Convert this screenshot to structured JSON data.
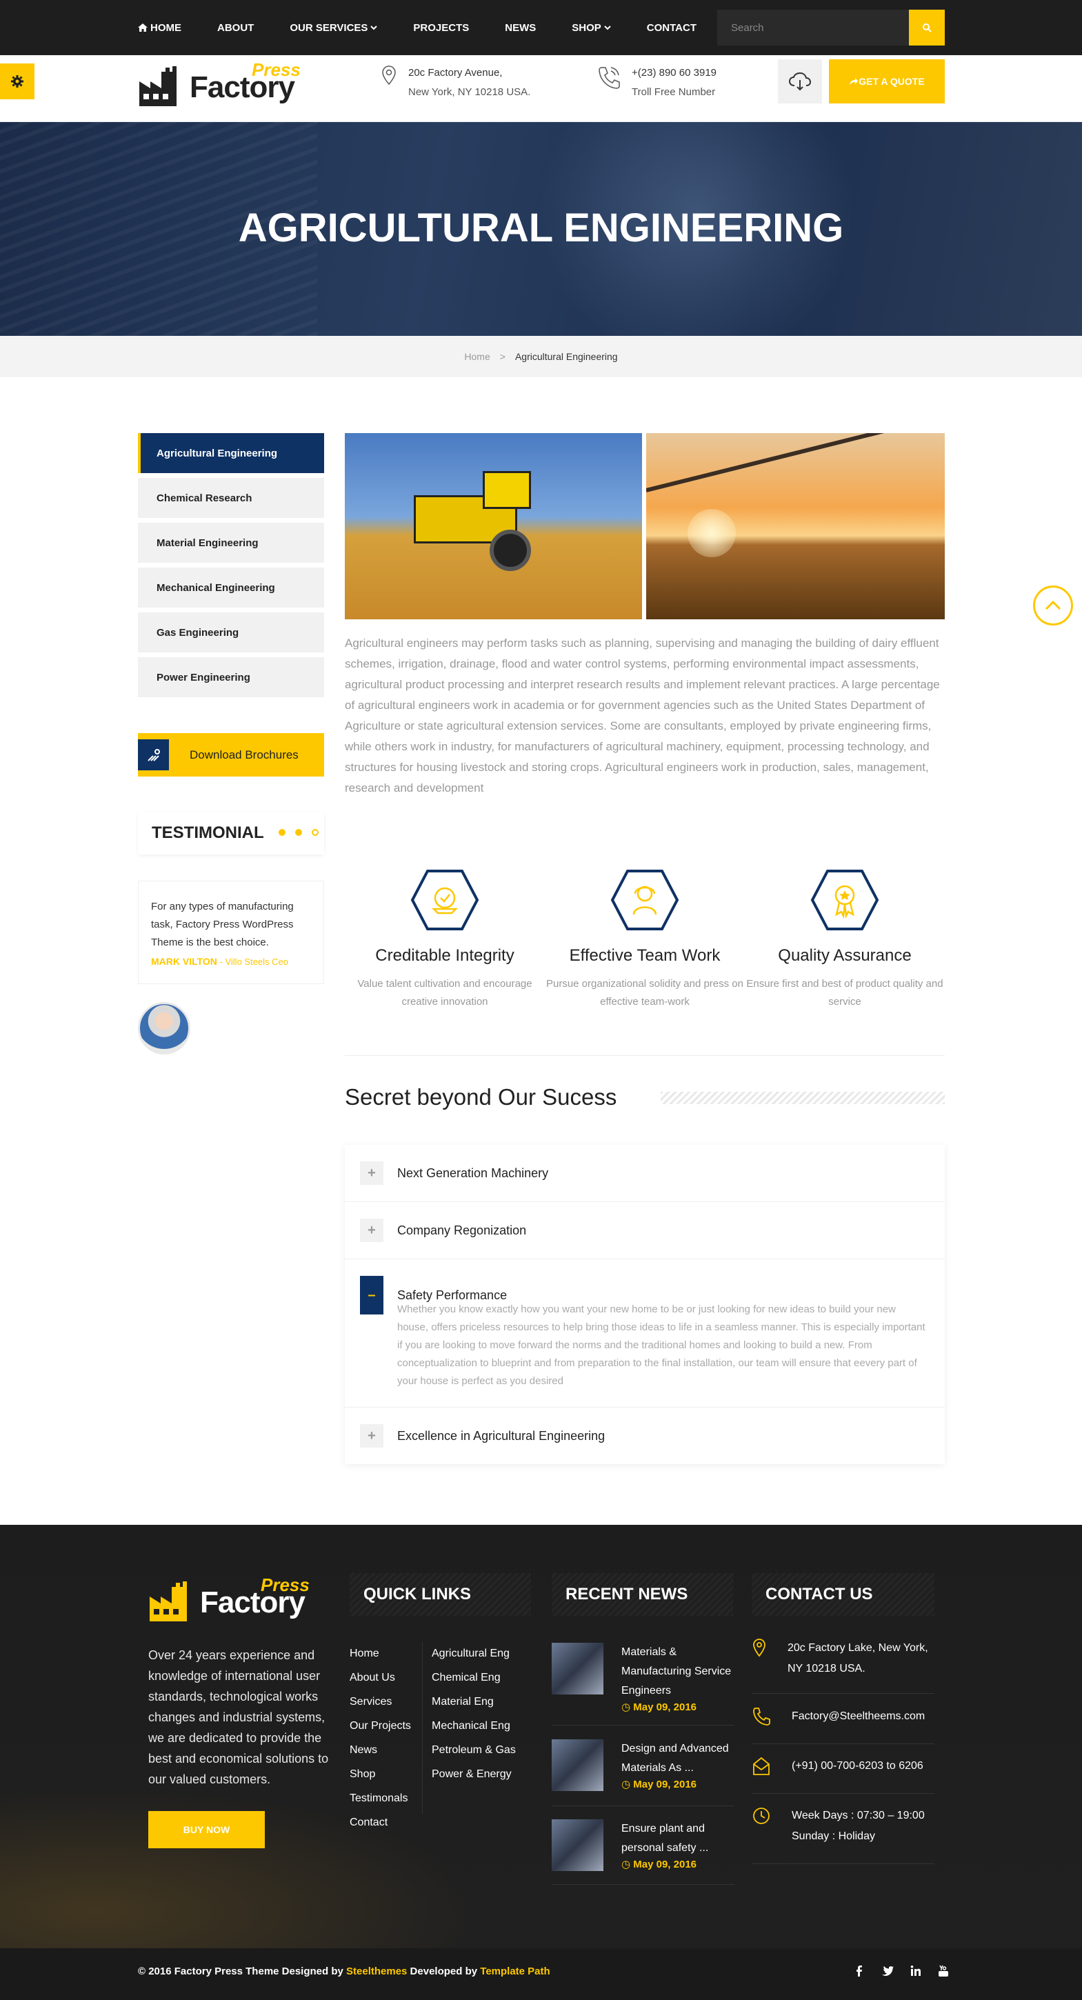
{
  "nav": {
    "items": [
      "HOME",
      "ABOUT",
      "OUR SERVICES",
      "PROJECTS",
      "NEWS",
      "SHOP",
      "CONTACT"
    ],
    "search_placeholder": "Search"
  },
  "header": {
    "logo_press": "Press",
    "logo_factory": "Factory",
    "address_line1": "20c Factory Avenue,",
    "address_line2": "New York, NY 10218 USA.",
    "phone": "+(23) 890 60 3919",
    "phone_label": "Troll Free Number",
    "quote_button": "GET A QUOTE"
  },
  "hero": {
    "title": "AGRICULTURAL ENGINEERING"
  },
  "breadcrumb": {
    "home": "Home",
    "separator": ">",
    "current": "Agricultural Engineering"
  },
  "sidebar": {
    "items": [
      {
        "label": "Agricultural Engineering",
        "active": true
      },
      {
        "label": "Chemical Research",
        "active": false
      },
      {
        "label": "Material Engineering",
        "active": false
      },
      {
        "label": "Mechanical Engineering",
        "active": false
      },
      {
        "label": "Gas Engineering",
        "active": false
      },
      {
        "label": "Power Engineering",
        "active": false
      }
    ],
    "download_label": "Download Brochures",
    "testimonial_title": "TESTIMONIAL",
    "testimonial_quote": "For any types of manufacturing task, Factory Press WordPress Theme is the best choice.",
    "testimonial_name": "MARK VILTON",
    "testimonial_position": " - Villo Steels Ceo"
  },
  "main": {
    "body": "Agricultural engineers may perform tasks such as planning, supervising and managing the building of dairy effluent schemes, irrigation, drainage, flood and water control systems, performing environmental impact assessments, agricultural product processing and interpret research results and implement relevant practices. A large percentage of agricultural engineers work in academia or for government agencies such as the United States Department of Agriculture or state agricultural extension services. Some are consultants, employed by private engineering firms, while others work in industry, for manufacturers of agricultural machinery, equipment, processing technology, and structures for housing livestock and storing crops. Agricultural engineers work in production, sales, management, research and development",
    "features": [
      {
        "title": "Creditable Integrity",
        "desc": "Value talent cultivation and encourage creative innovation",
        "icon": "integrity-icon"
      },
      {
        "title": "Effective Team Work",
        "desc": "Pursue organizational solidity and press on effective team-work",
        "icon": "team-icon"
      },
      {
        "title": "Quality Assurance",
        "desc": "Ensure first and best of product quality and service",
        "icon": "award-icon"
      }
    ],
    "section_title": "Secret beyond Our Sucess",
    "accordion": [
      {
        "label": "Next Generation Machinery",
        "open": false,
        "content": ""
      },
      {
        "label": "Company Regonization",
        "open": false,
        "content": ""
      },
      {
        "label": "Safety Performance",
        "open": true,
        "content": "Whether you know exactly how you want your new home to be or just looking for new ideas to build your new house, offers priceless resources to help bring those ideas to life in a seamless manner. This is especially important if you are looking to move forward the norms and the traditional homes and looking to build a new. From conceptualization to blueprint and from preparation to the final installation, our team will ensure that eevery part of your house is perfect as you desired"
      },
      {
        "label": "Excellence in Agricultural Engineering",
        "open": false,
        "content": ""
      }
    ]
  },
  "footer": {
    "logo_press": "Press",
    "logo_factory": "Factory",
    "about": "Over 24 years experience and knowledge of international user standards, technological works changes and industrial systems, we are dedicated to provide the best and economical solutions to our valued customers.",
    "buy_button": "BUY NOW",
    "quick_links_title": "QUICK LINKS",
    "quick_links_col1": [
      "Home",
      "About Us",
      "Services",
      "Our Projects",
      "News",
      "Shop",
      "Testimonals",
      "Contact"
    ],
    "quick_links_col2": [
      "Agricultural Eng",
      "Chemical Eng",
      "Material Eng",
      "Mechanical Eng",
      "Petroleum & Gas",
      "Power & Energy"
    ],
    "recent_news_title": "RECENT NEWS",
    "news": [
      {
        "title": "Materials & Manufacturing Service Engineers",
        "date": "May 09, 2016"
      },
      {
        "title": "Design and Advanced Materials As ...",
        "date": "May 09, 2016"
      },
      {
        "title": "Ensure plant and personal safety ...",
        "date": "May 09, 2016"
      }
    ],
    "contact_title": "CONTACT US",
    "contact_address": "20c Factory Lake, New York, NY 10218 USA.",
    "contact_email": "Factory@Steeltheems.com",
    "contact_phone": "(+91) 00-700-6203 to 6206",
    "contact_hours_1": "Week Days : 07:30 – 19:00",
    "contact_hours_2": "Sunday : Holiday"
  },
  "bottom": {
    "copy_prefix": "© 2016 Factory Press Theme Designed by ",
    "designer": "Steelthemes",
    "copy_mid": " Developed by ",
    "developer": "Template Path"
  },
  "colors": {
    "accent": "#fdc800",
    "navy": "#0f3264",
    "dark": "#1e1e1e"
  }
}
